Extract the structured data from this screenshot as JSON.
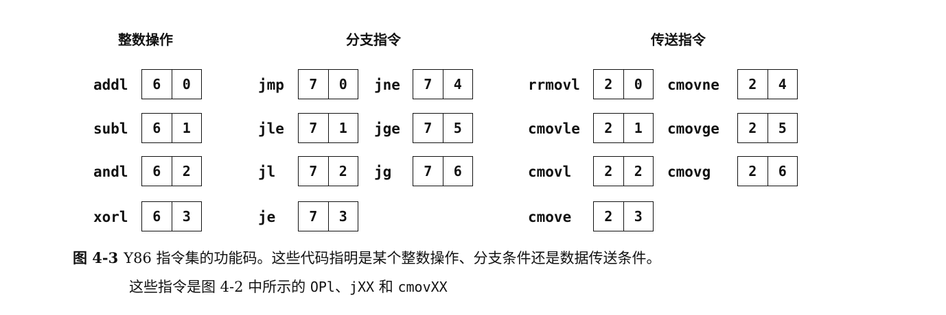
{
  "groups": {
    "integer_ops": {
      "title": "整数操作",
      "items": [
        {
          "mnemonic": "addl",
          "hi": "6",
          "lo": "0"
        },
        {
          "mnemonic": "subl",
          "hi": "6",
          "lo": "1"
        },
        {
          "mnemonic": "andl",
          "hi": "6",
          "lo": "2"
        },
        {
          "mnemonic": "xorl",
          "hi": "6",
          "lo": "3"
        }
      ]
    },
    "branch": {
      "title": "分支指令",
      "items": [
        {
          "mnemonic": "jmp",
          "hi": "7",
          "lo": "0"
        },
        {
          "mnemonic": "jle",
          "hi": "7",
          "lo": "1"
        },
        {
          "mnemonic": "jl",
          "hi": "7",
          "lo": "2"
        },
        {
          "mnemonic": "je",
          "hi": "7",
          "lo": "3"
        },
        {
          "mnemonic": "jne",
          "hi": "7",
          "lo": "4"
        },
        {
          "mnemonic": "jge",
          "hi": "7",
          "lo": "5"
        },
        {
          "mnemonic": "jg",
          "hi": "7",
          "lo": "6"
        }
      ]
    },
    "move": {
      "title": "传送指令",
      "items": [
        {
          "mnemonic": "rrmovl",
          "hi": "2",
          "lo": "0"
        },
        {
          "mnemonic": "cmovle",
          "hi": "2",
          "lo": "1"
        },
        {
          "mnemonic": "cmovl",
          "hi": "2",
          "lo": "2"
        },
        {
          "mnemonic": "cmove",
          "hi": "2",
          "lo": "3"
        },
        {
          "mnemonic": "cmovne",
          "hi": "2",
          "lo": "4"
        },
        {
          "mnemonic": "cmovge",
          "hi": "2",
          "lo": "5"
        },
        {
          "mnemonic": "cmovg",
          "hi": "2",
          "lo": "6"
        }
      ]
    }
  },
  "caption": {
    "label": "图 4-3",
    "text": "Y86 指令集的功能码。这些代码指明是某个整数操作、分支条件还是数据传送条件。",
    "line2_prefix": "这些指令是图 4-2 中所示的 ",
    "code_op": "OPl",
    "sep": "、",
    "code_jxx": "jXX",
    "and_word": " 和 ",
    "code_cmov": "cmovXX"
  }
}
